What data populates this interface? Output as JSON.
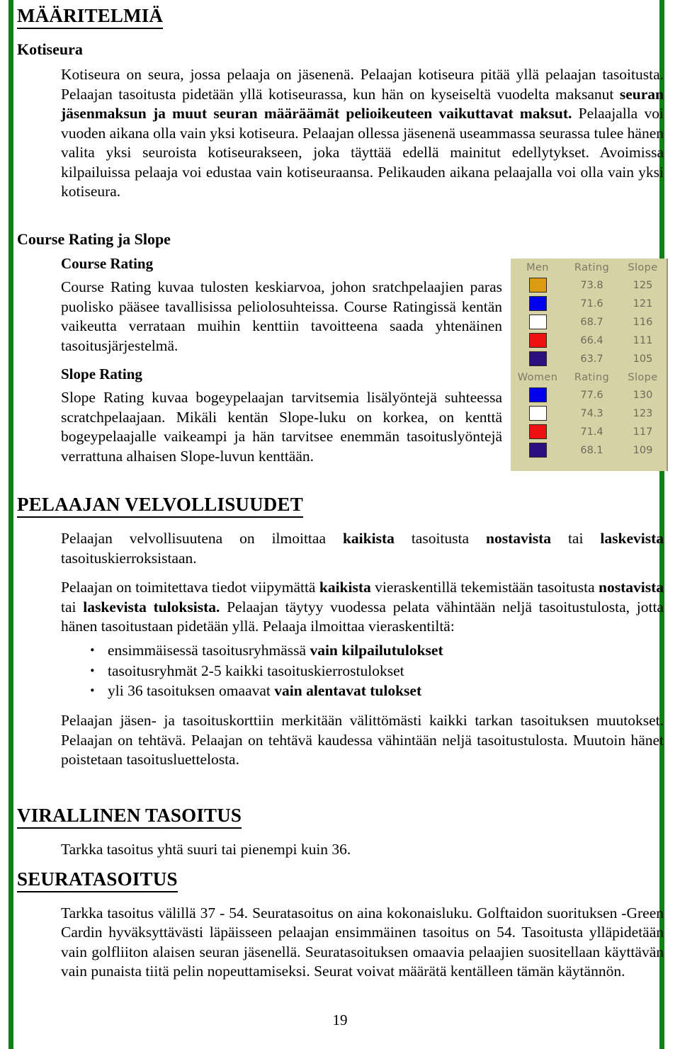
{
  "document": {
    "page_number": "19",
    "accent_color": "#128012"
  },
  "sections": {
    "definitions": {
      "heading": "MÄÄRITELMIÄ",
      "home_club": {
        "heading": "Kotiseura",
        "p1_a": "Kotiseura on seura, jossa pelaaja on jäsenenä. Pelaajan kotiseura pitää yllä pelaajan tasoitusta. Pelaajan tasoitusta pidetään yllä kotiseurassa, kun hän on kyseiseltä vuodelta maksanut ",
        "p1_b": "seuran jäsenmaksun ja muut seuran määräämät pelioikeuteen vaikuttavat maksut.",
        "p1_c": " Pelaajalla voi vuoden aikana olla vain yksi kotiseura. Pelaajan ollessa jäsenenä useammassa seurassa tulee hänen valita yksi seuroista kotiseurakseen, joka täyttää edellä mainitut edellytykset. Avoimissa kilpailuissa pelaaja voi edustaa vain kotiseuraansa. Pelikauden aikana pelaajalla voi olla vain yksi kotiseura."
      }
    },
    "course_rating_slope": {
      "heading": "Course Rating ja Slope",
      "course_rating": {
        "heading": "Course Rating",
        "text": "Course Rating kuvaa tulosten keskiarvoa, johon sratchpelaajien paras puolisko pääsee tavallisissa peliolosuhteissa. Course Ratingissä kentän vaikeutta verrataan muihin kenttiin tavoitteena saada yhtenäinen tasoitusjärjestelmä."
      },
      "slope_rating": {
        "heading": "Slope Rating",
        "text": "Slope Rating kuvaa bogeypelaajan tarvitsemia lisälyöntejä suhteessa scratchpelaajaan. Mikäli kentän Slope-luku on korkea, on kenttä bogeypelaajalle vaikeampi ja hän tarvitsee enemmän tasoituslyöntejä verrattuna alhaisen Slope-luvun kenttään."
      }
    },
    "player_duties": {
      "heading": "PELAAJAN VELVOLLISUUDET",
      "p1_a": "Pelaajan velvollisuutena on ilmoittaa ",
      "p1_b": "kaikista",
      "p1_c": " tasoitusta ",
      "p1_d": "nostavista",
      "p1_e": " tai ",
      "p1_f": "laskevista",
      "p1_g": " tasoituskierroksistaan.",
      "p2_a": "Pelaajan on toimitettava tiedot viipymättä ",
      "p2_b": "kaikista",
      "p2_c": " vieraskentillä tekemistään tasoitusta ",
      "p2_d": "nostavista",
      "p2_e": " tai ",
      "p2_f": "laskevista tuloksista.",
      "p2_g": " Pelaajan täytyy vuodessa pelata vähintään neljä tasoitustulosta, jotta hänen tasoitustaan pidetään yllä. Pelaaja ilmoittaa vieraskentiltä:",
      "bullets": [
        {
          "plain": "ensimmäisessä tasoitusryhmässä ",
          "bold": "vain kilpailutulokset"
        },
        {
          "plain": "tasoitusryhmät 2-5 kaikki tasoituskierrostulokset",
          "bold": ""
        },
        {
          "plain": "yli 36 tasoituksen omaavat ",
          "bold": "vain alentavat tulokset"
        }
      ],
      "p3": "Pelaajan jäsen- ja tasoituskorttiin merkitään välittömästi kaikki tarkan tasoituksen muutokset. Pelaajan on tehtävä. Pelaajan on tehtävä kaudessa vähintään neljä tasoitustulosta. Muutoin hänet poistetaan tasoitusluettelosta."
    },
    "official_handicap": {
      "heading": "VIRALLINEN TASOITUS",
      "text": "Tarkka tasoitus yhtä suuri tai pienempi kuin 36."
    },
    "club_handicap": {
      "heading": "SEURATASOITUS",
      "text": "Tarkka tasoitus välillä 37 - 54. Seuratasoitus on aina kokonaisluku. Golftaidon suorituksen -Green Cardin hyväksyttävästi läpäisseen pelaajan ensimmäinen tasoitus on 54. Tasoitusta ylläpidetään vain golfliiton alaisen seuran jäsenellä. Seuratasoituksen omaavia pelaajien suositellaan käyttävän vain punaista tiitä pelin nopeuttamiseksi. Seurat voivat määrätä kentälleen tämän käytännön."
    }
  },
  "rating_table": {
    "background_color": "#d6d2a6",
    "groups": [
      {
        "label": "Men",
        "columns": [
          "Men",
          "Rating",
          "Slope"
        ],
        "rows": [
          {
            "color": "#dd9b12",
            "rating": "73.8",
            "slope": "125"
          },
          {
            "color": "#0000ee",
            "rating": "71.6",
            "slope": "121"
          },
          {
            "color": "#ffffff",
            "rating": "68.7",
            "slope": "116"
          },
          {
            "color": "#ee1111",
            "rating": "66.4",
            "slope": "111"
          },
          {
            "color": "#2d1080",
            "rating": "63.7",
            "slope": "105"
          }
        ]
      },
      {
        "label": "Women",
        "columns": [
          "Women",
          "Rating",
          "Slope"
        ],
        "rows": [
          {
            "color": "#0000ee",
            "rating": "77.6",
            "slope": "130"
          },
          {
            "color": "#ffffff",
            "rating": "74.3",
            "slope": "123"
          },
          {
            "color": "#ee1111",
            "rating": "71.4",
            "slope": "117"
          },
          {
            "color": "#2d1080",
            "rating": "68.1",
            "slope": "109"
          }
        ]
      }
    ]
  }
}
